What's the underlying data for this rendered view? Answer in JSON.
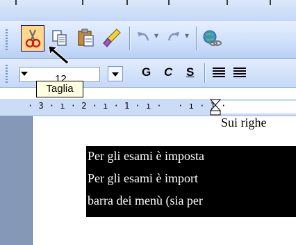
{
  "toolbar": {
    "tooltip": "Taglia",
    "buttons": [
      {
        "name": "cut",
        "icon": "scissors-icon",
        "active": true
      },
      {
        "name": "copy",
        "icon": "copy-icon"
      },
      {
        "name": "paste",
        "icon": "paste-icon"
      },
      {
        "name": "format-painter",
        "icon": "format-painter-icon"
      },
      {
        "name": "undo",
        "icon": "undo-icon"
      },
      {
        "name": "redo",
        "icon": "redo-icon"
      },
      {
        "name": "hyperlink",
        "icon": "hyperlink-icon"
      }
    ]
  },
  "format": {
    "font_size": "12",
    "bold": "G",
    "italic": "C",
    "underline": "S"
  },
  "ruler": {
    "marks": "· 3 · ı · 2 · ı · 1 · ı ·   · ı · 1 ·"
  },
  "document": {
    "partial_line": "Sui righe",
    "lines": [
      "Per gli esami è imposta",
      "Per gli esami è import",
      "barra dei menù (sia per"
    ]
  },
  "colors": {
    "selection": "#000000",
    "active_button": "#ffd98a",
    "tooltip_bg": "#ffffe1"
  }
}
